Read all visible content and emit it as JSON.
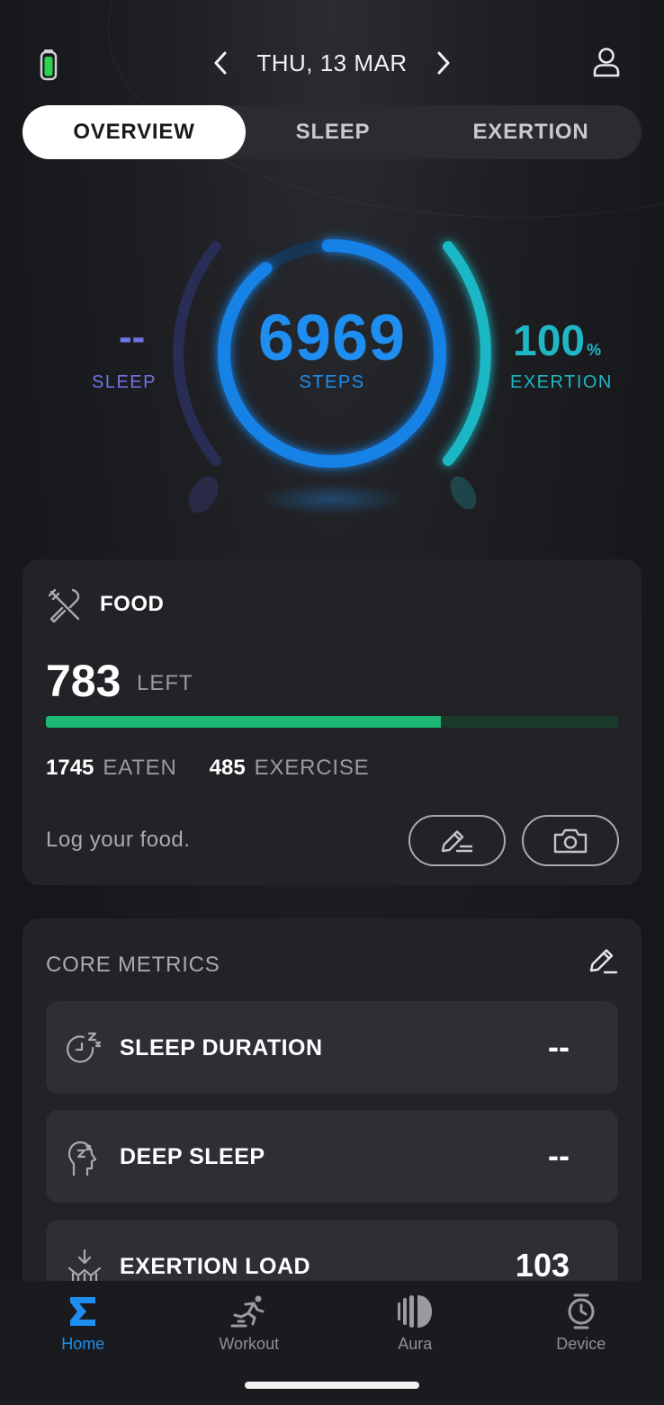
{
  "header": {
    "date": "THU, 13 MAR",
    "icons": {
      "battery": "battery-icon",
      "prev": "chevron-left-icon",
      "next": "chevron-right-icon",
      "profile": "profile-icon"
    }
  },
  "tabs": [
    {
      "label": "OVERVIEW",
      "active": true
    },
    {
      "label": "SLEEP",
      "active": false
    },
    {
      "label": "EXERTION",
      "active": false
    }
  ],
  "rings": {
    "steps": {
      "value": "6969",
      "label": "STEPS"
    },
    "sleep": {
      "value": "--",
      "label": "SLEEP"
    },
    "exertion": {
      "value": "100",
      "unit": "%",
      "label": "EXERTION"
    }
  },
  "food": {
    "title": "FOOD",
    "left_value": "783",
    "left_label": "LEFT",
    "progress": 0.69,
    "eaten_value": "1745",
    "eaten_label": "EATEN",
    "exercise_value": "485",
    "exercise_label": "EXERCISE",
    "log_text": "Log your food."
  },
  "core_metrics": {
    "title": "CORE METRICS",
    "items": [
      {
        "label": "SLEEP DURATION",
        "value": "--",
        "icon": "sleep-clock-icon"
      },
      {
        "label": "DEEP SLEEP",
        "value": "--",
        "icon": "deep-sleep-icon"
      },
      {
        "label": "EXERTION LOAD",
        "value": "103",
        "icon": "exertion-load-icon"
      }
    ]
  },
  "nav": [
    {
      "label": "Home",
      "active": true,
      "icon": "sigma-home-icon"
    },
    {
      "label": "Workout",
      "active": false,
      "icon": "workout-runner-icon"
    },
    {
      "label": "Aura",
      "active": false,
      "icon": "aura-icon"
    },
    {
      "label": "Device",
      "active": false,
      "icon": "watch-icon"
    }
  ],
  "colors": {
    "steps": "#1e8ef0",
    "sleep": "#6f75e6",
    "exertion": "#1fb7c4",
    "food_progress": "#1db874"
  }
}
